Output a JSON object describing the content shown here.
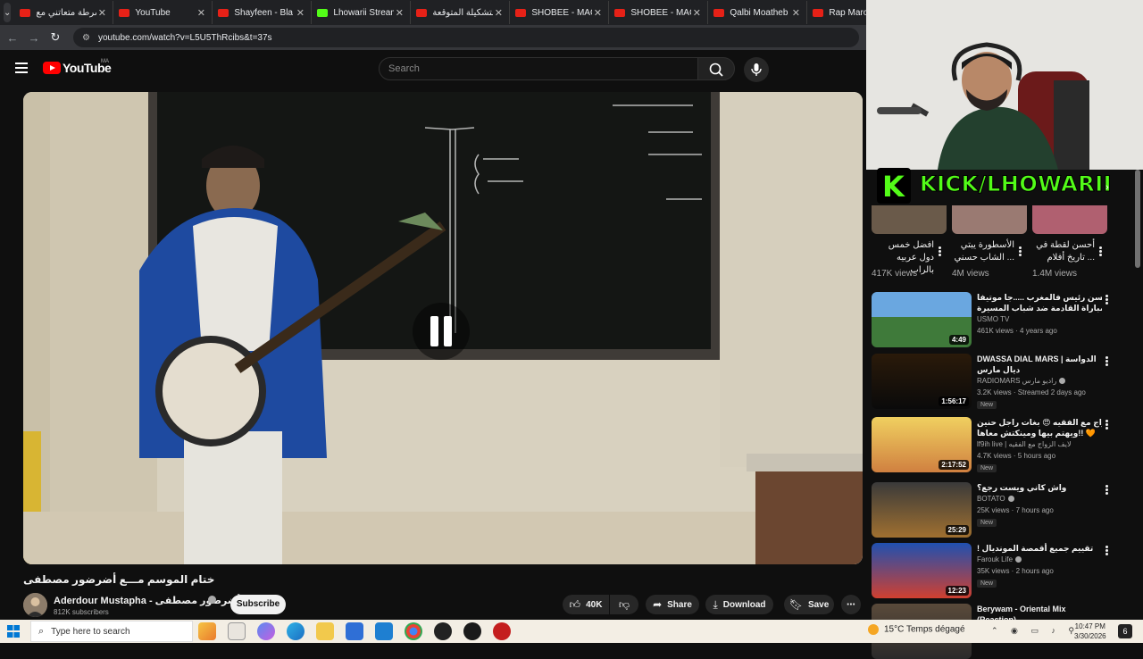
{
  "browser": {
    "tabs": [
      {
        "title": "الشرطة متعاتني مع",
        "icon": "youtube-icon"
      },
      {
        "title": "YouTube",
        "icon": "youtube-icon"
      },
      {
        "title": "Shayfeen - Bla M",
        "icon": "youtube-icon"
      },
      {
        "title": "Lhowarii Stream -",
        "icon": "kick-icon"
      },
      {
        "title": "التشكيلة المتوقعة",
        "icon": "youtube-icon"
      },
      {
        "title": "SHOBEE - MACHI",
        "icon": "youtube-icon"
      },
      {
        "title": "SHOBEE - MACHI",
        "icon": "youtube-icon"
      },
      {
        "title": "Qalbi Moatheb",
        "icon": "youtube-icon"
      },
      {
        "title": "Rap Maroc",
        "icon": "youtube-icon"
      }
    ],
    "url": "youtube.com/watch?v=L5U5ThRcibs&t=37s"
  },
  "youtube": {
    "logo_text": "YouTube",
    "country_code": "MA",
    "search_placeholder": "Search"
  },
  "video": {
    "title": "ختام الموسم مـــع أضرضور مصطفى",
    "channel_name": "Aderdour Mustapha - أضرضور مصطفى",
    "subscribers": "812K subscribers",
    "subscribe_label": "Subscribe",
    "likes": "40K",
    "share_label": "Share",
    "download_label": "Download",
    "save_label": "Save"
  },
  "overlay": {
    "kick_text": "KICK/LHOWARII"
  },
  "shorts": [
    {
      "title": "افضل خمس دول عربيه بالراب",
      "views": "417K views"
    },
    {
      "title": "الأسطورة يبتي ... الشاب حسني",
      "views": "4M views"
    },
    {
      "title": "أحسن لقطة في ... تاريخ أفلام",
      "views": "1.4M views"
    }
  ],
  "recommendations": [
    {
      "title": "سي جلال أحسن رئيس فالمغرب .....جا موتيفا",
      "title2": "اللاعبة المباراة القادمة ضد شباب المسيرة",
      "channel": "USMO TV",
      "verified": false,
      "meta": "461K views · 4 years ago",
      "duration": "4:49",
      "new": false
    },
    {
      "title": "DWASSA DIAL MARS | الدواسة",
      "title2": "ديال مارس",
      "channel": "RADIOMARS راديو مارس",
      "verified": true,
      "meta": "3.2K views · Streamed 2 days ago",
      "duration": "1:56:17",
      "new": true
    },
    {
      "title": "برنامج الزواج مع الفقيه 😍 بغات راجل حنين",
      "title2": "ويهتم بيها ومينكتش معاها!! 🧡",
      "channel": "lf9ih live | لايف الزواج مع الفقيه",
      "verified": false,
      "meta": "4.7K views · 5 hours ago",
      "duration": "2:17:52",
      "new": true
    },
    {
      "title": "واش كاني ويست رجع؟",
      "title2": "",
      "channel": "BOTATO",
      "verified": true,
      "meta": "25K views · 7 hours ago",
      "duration": "25:29",
      "new": true
    },
    {
      "title": "! تقييم جميع أقمصة المونديال",
      "title2": "",
      "channel": "Farouk Life",
      "verified": true,
      "meta": "35K views · 2 hours ago",
      "duration": "12:23",
      "new": true
    },
    {
      "title": "Berywam - Oriental Mix",
      "title2": "(Reaction)",
      "channel": "",
      "verified": false,
      "meta": "",
      "duration": "",
      "new": false
    }
  ],
  "new_label": "New",
  "taskbar": {
    "search_placeholder": "Type here to search",
    "weather": "15°C  Temps dégagé",
    "time": "10:47 PM",
    "date": "3/30/2026",
    "notifications": "6"
  }
}
